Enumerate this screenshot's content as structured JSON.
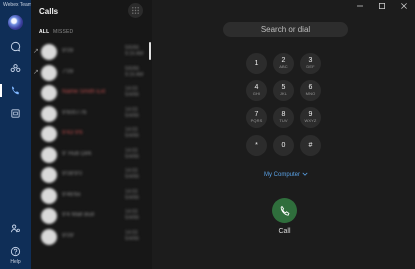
{
  "app": {
    "title": "Webex Teams"
  },
  "rail": {
    "items": [
      {
        "icon": "chat-icon",
        "label": "Messaging"
      },
      {
        "icon": "teams-icon",
        "label": "Teams"
      },
      {
        "icon": "phone-icon",
        "label": "Calls",
        "active": true
      },
      {
        "icon": "meetings-icon",
        "label": "Meetings"
      }
    ],
    "help_label": "Help"
  },
  "calls": {
    "title": "Calls",
    "filters": {
      "all": "ALL",
      "missed": "MISSED"
    },
    "entries": [
      {
        "direction": "↗",
        "name": "9'09",
        "time": "5/6/66\n9:16 AM",
        "missed": false
      },
      {
        "direction": "↗",
        "name": "7'09",
        "time": "5/6/66\n9:16 AM",
        "missed": false
      },
      {
        "direction": "",
        "name": "Name Smith Ext",
        "name2": "xxxxxxxxxxxx",
        "time": "14:03\n5/4/66",
        "missed": true
      },
      {
        "direction": "",
        "name": "9'600776",
        "time": "14:03\n5/4/66",
        "missed": false
      },
      {
        "direction": "",
        "name": "9'43 9'6",
        "time": "14:03\n5/4/66",
        "missed": true
      },
      {
        "direction": "",
        "name": "9' Hub Dirk",
        "time": "14:03\n5/4/66",
        "missed": false
      },
      {
        "direction": "",
        "name": "9'08'9'0",
        "time": "14:03\n5/4/66",
        "missed": false
      },
      {
        "direction": "",
        "name": "9'46'6x",
        "time": "14:03\n5/4/66",
        "missed": false
      },
      {
        "direction": "",
        "name": "9'4 Mall Bull",
        "time": "14:03\n5/4/66",
        "missed": false
      },
      {
        "direction": "",
        "name": "9'09'",
        "time": "14:03\n5/4/66",
        "missed": false
      }
    ]
  },
  "dialer": {
    "search_placeholder": "Search or dial",
    "keys": [
      {
        "digit": "1",
        "letters": ""
      },
      {
        "digit": "2",
        "letters": "ABC"
      },
      {
        "digit": "3",
        "letters": "DEF"
      },
      {
        "digit": "4",
        "letters": "GHI"
      },
      {
        "digit": "5",
        "letters": "JKL"
      },
      {
        "digit": "6",
        "letters": "MNO"
      },
      {
        "digit": "7",
        "letters": "PQRS"
      },
      {
        "digit": "8",
        "letters": "TUV"
      },
      {
        "digit": "9",
        "letters": "WXYZ"
      },
      {
        "digit": "*",
        "letters": ""
      },
      {
        "digit": "0",
        "letters": ""
      },
      {
        "digit": "#",
        "letters": ""
      }
    ],
    "device": "My Computer",
    "call_label": "Call"
  },
  "colors": {
    "rail": "#0f2e57",
    "accent_link": "#5aa2e6",
    "call_button": "#2f6e3c",
    "missed": "#b84a4a"
  }
}
